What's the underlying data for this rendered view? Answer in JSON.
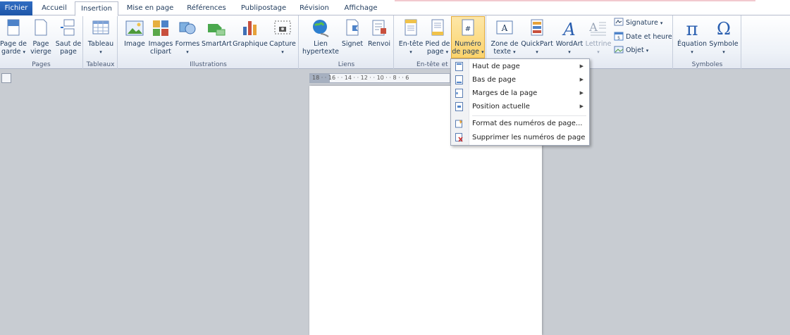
{
  "tabs": [
    "Fichier",
    "Accueil",
    "Insertion",
    "Mise en page",
    "Références",
    "Publipostage",
    "Révision",
    "Affichage"
  ],
  "active_tab": "Insertion",
  "groups": {
    "pages": {
      "label": "Pages",
      "buttons": [
        {
          "label": "Page de garde",
          "icon": "cover-page-icon"
        },
        {
          "label": "Page vierge",
          "icon": "blank-page-icon"
        },
        {
          "label": "Saut de page",
          "icon": "page-break-icon"
        }
      ]
    },
    "tableaux": {
      "label": "Tableaux",
      "buttons": [
        {
          "label": "Tableau",
          "icon": "table-icon"
        }
      ]
    },
    "illustrations": {
      "label": "Illustrations",
      "buttons": [
        {
          "label": "Image",
          "icon": "picture-icon"
        },
        {
          "label": "Images clipart",
          "icon": "clipart-icon"
        },
        {
          "label": "Formes",
          "icon": "shapes-icon"
        },
        {
          "label": "SmartArt",
          "icon": "smartart-icon"
        },
        {
          "label": "Graphique",
          "icon": "chart-icon"
        },
        {
          "label": "Capture",
          "icon": "screenshot-icon"
        }
      ]
    },
    "liens": {
      "label": "Liens",
      "buttons": [
        {
          "label": "Lien hypertexte",
          "icon": "hyperlink-icon"
        },
        {
          "label": "Signet",
          "icon": "bookmark-icon"
        },
        {
          "label": "Renvoi",
          "icon": "cross-reference-icon"
        }
      ]
    },
    "entete": {
      "label": "En-tête et pied",
      "buttons": [
        {
          "label": "En-tête",
          "icon": "header-icon"
        },
        {
          "label": "Pied de page",
          "icon": "footer-icon"
        },
        {
          "label": "Numéro de page",
          "icon": "page-number-icon"
        }
      ]
    },
    "texte": {
      "buttons": [
        {
          "label": "Zone de texte",
          "icon": "textbox-icon"
        },
        {
          "label": "QuickPart",
          "icon": "quickpart-icon"
        },
        {
          "label": "WordArt",
          "icon": "wordart-icon"
        },
        {
          "label": "Lettrine",
          "icon": "dropcap-icon"
        }
      ],
      "small": [
        {
          "label": "Signature",
          "icon": "signature-icon"
        },
        {
          "label": "Date et heure",
          "icon": "date-time-icon"
        },
        {
          "label": "Objet",
          "icon": "object-icon"
        }
      ]
    },
    "symboles": {
      "label": "Symboles",
      "buttons": [
        {
          "label": "Équation",
          "icon": "equation-icon"
        },
        {
          "label": "Symbole",
          "icon": "symbol-icon"
        }
      ]
    }
  },
  "ruler_ticks": "18 · · 16 · · 14 · · 12 · · 10 · · 8 · · 6",
  "menu": {
    "items": [
      {
        "label": "Haut de page",
        "submenu": true,
        "icon": "page-top-icon"
      },
      {
        "label": "Bas de page",
        "submenu": true,
        "icon": "page-bottom-icon"
      },
      {
        "label": "Marges de la page",
        "submenu": true,
        "icon": "page-margins-icon"
      },
      {
        "label": "Position actuelle",
        "submenu": true,
        "icon": "current-position-icon"
      },
      {
        "label": "Format des numéros de page...",
        "submenu": false,
        "icon": "format-page-numbers-icon"
      },
      {
        "label": "Supprimer les numéros de page",
        "submenu": false,
        "icon": "remove-page-numbers-icon"
      }
    ]
  },
  "colors": {
    "file_tab": "#2a63b8",
    "active_button": "#fbd36c",
    "ribbon": "#eef2f8",
    "workspace": "#c8ccd2"
  }
}
